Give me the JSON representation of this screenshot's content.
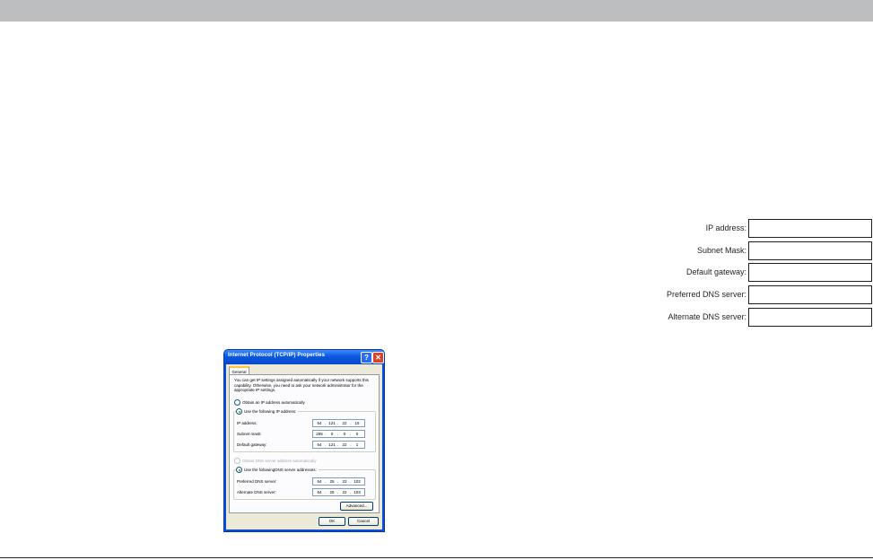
{
  "blank_form": {
    "fields": [
      {
        "label": "IP address:"
      },
      {
        "label": "Subnet Mask:"
      },
      {
        "label": "Default gateway:"
      },
      {
        "label": "Preferred DNS server:"
      },
      {
        "label": "Alternate DNS server:"
      }
    ]
  },
  "dialog": {
    "title": "Internet Protocol (TCP/IP) Properties",
    "help_glyph": "?",
    "close_glyph": "✕",
    "tab": "General",
    "intro": "You can get IP settings assigned automatically if your network supports this capability. Otherwise, you need to ask your network administrator for the appropriate IP settings.",
    "radio_obtain_ip": "Obtain an IP address automatically",
    "radio_use_ip": "Use the following IP address:",
    "ip_fields": [
      {
        "label": "IP address:",
        "octets": [
          "64",
          "121",
          "22",
          "15"
        ]
      },
      {
        "label": "Subnet mask:",
        "octets": [
          "255",
          "0",
          "0",
          "0"
        ]
      },
      {
        "label": "Default gateway:",
        "octets": [
          "64",
          "121",
          "22",
          "1"
        ]
      }
    ],
    "radio_obtain_dns": "Obtain DNS server address automatically",
    "radio_use_dns": "Use the followingDNS server addresses:",
    "dns_fields": [
      {
        "label": "Preferred DNS server:",
        "octets": [
          "64",
          "25",
          "22",
          "102"
        ]
      },
      {
        "label": "Alternate DNS server:",
        "octets": [
          "64",
          "25",
          "22",
          "103"
        ]
      }
    ],
    "advanced_label": "Advanced...",
    "ok_label": "OK",
    "cancel_label": "Cancel"
  },
  "colors": {
    "top_bar": "#bcbec0",
    "xp_title_blue": "#0b58e0",
    "dialog_face": "#ece9d8"
  }
}
